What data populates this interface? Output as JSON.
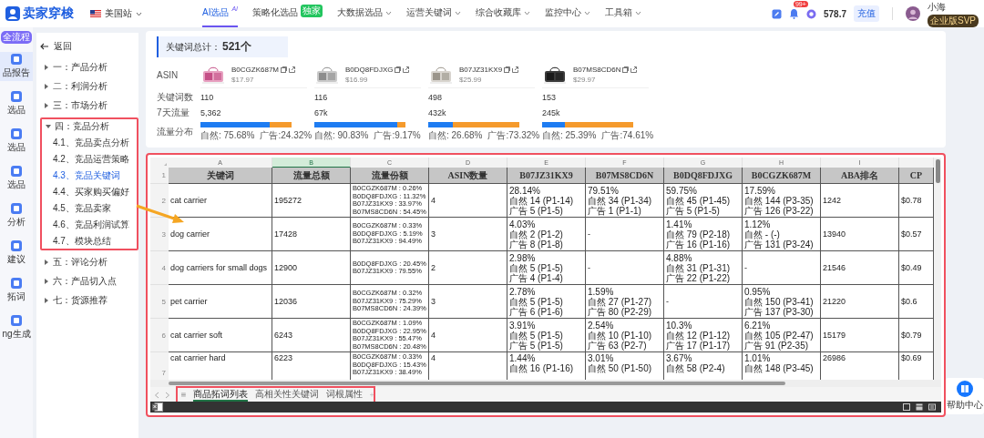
{
  "topbar": {
    "logo": "卖家穿梭",
    "site": "美国站",
    "nav": [
      {
        "label": "AI选品",
        "selected": true,
        "badge": {
          "kind": "sup",
          "text": "AI"
        }
      },
      {
        "label": "策略化选品",
        "selected": false,
        "badge": {
          "kind": "tag",
          "text": "独家"
        }
      },
      {
        "label": "大数据选品",
        "selected": false,
        "dropdown": true
      },
      {
        "label": "运营关键词",
        "selected": false,
        "dropdown": true
      },
      {
        "label": "综合收藏库",
        "selected": false,
        "dropdown": true
      },
      {
        "label": "监控中心",
        "selected": false,
        "dropdown": true
      },
      {
        "label": "工具箱",
        "selected": false,
        "dropdown": true
      }
    ],
    "notifications": "99+",
    "balance": "578.7",
    "recharge": "充值",
    "user": {
      "name": "小海",
      "plan": "企业版SVP"
    }
  },
  "rail": {
    "badge": "全流程",
    "items": [
      {
        "label": "品报告",
        "selected": true
      },
      {
        "label": "选品",
        "selected": false
      },
      {
        "label": "选品",
        "selected": false
      },
      {
        "label": "选品",
        "selected": false
      },
      {
        "label": "分析",
        "selected": false
      },
      {
        "label": "建议",
        "selected": false
      },
      {
        "label": "拓词",
        "selected": false
      },
      {
        "label": "ng生成",
        "selected": false
      }
    ]
  },
  "outline": {
    "back": "返回",
    "items": [
      {
        "label": "一：产品分析",
        "expanded": false,
        "highlighted": false
      },
      {
        "label": "二：利润分析",
        "expanded": false,
        "highlighted": false
      },
      {
        "label": "三：市场分析",
        "expanded": false,
        "highlighted": false
      },
      {
        "label": "四：竞品分析",
        "expanded": true,
        "highlighted": true,
        "children": [
          {
            "label": "4.1、竞品卖点分析",
            "selected": false
          },
          {
            "label": "4.2、竞品运营策略",
            "selected": false
          },
          {
            "label": "4.3、竞品关键词",
            "selected": true
          },
          {
            "label": "4.4、买家购买偏好",
            "selected": false
          },
          {
            "label": "4.5、竞品卖家",
            "selected": false
          },
          {
            "label": "4.6、竞品利润试算",
            "selected": false
          },
          {
            "label": "4.7、模块总结",
            "selected": false
          }
        ]
      },
      {
        "label": "五：评论分析",
        "expanded": false,
        "highlighted": false
      },
      {
        "label": "六：产品切入点",
        "expanded": false,
        "highlighted": false
      },
      {
        "label": "七：货源推荐",
        "expanded": false,
        "highlighted": false
      }
    ]
  },
  "summary": {
    "title": "关键词总计：",
    "count": "521个",
    "row_labels": [
      "ASIN",
      "关键词数",
      "7天流量",
      "流量分布"
    ],
    "products": [
      {
        "asin": "B0CGZK687M",
        "price": "$17.97",
        "keywords": "110",
        "traffic": "5,362",
        "level": 0.7568,
        "natural": "自然: 75.68%",
        "ad": "广告:24.32%"
      },
      {
        "asin": "B0DQ8FDJXG",
        "price": "$16.99",
        "keywords": "116",
        "traffic": "67k",
        "level": 0.9083,
        "natural": "自然: 90.83%",
        "ad": "广告:9.17%"
      },
      {
        "asin": "B07JZ31KX9",
        "price": "$25.99",
        "keywords": "498",
        "traffic": "432k",
        "level": 0.2668,
        "natural": "自然: 26.68%",
        "ad": "广告:73.32%"
      },
      {
        "asin": "B07MS8CD6N",
        "price": "$29.97",
        "keywords": "153",
        "traffic": "245k",
        "level": 0.2539,
        "natural": "自然: 25.39%",
        "ad": "广告:74.61%"
      }
    ]
  },
  "sheet": {
    "highlighted": true,
    "column_letters": [
      {
        "label": "A",
        "selected": false
      },
      {
        "label": "B",
        "selected": true
      },
      {
        "label": "C",
        "selected": false
      },
      {
        "label": "D",
        "selected": false
      },
      {
        "label": "E",
        "selected": false
      },
      {
        "label": "F",
        "selected": false
      },
      {
        "label": "G",
        "selected": false
      },
      {
        "label": "H",
        "selected": false
      },
      {
        "label": "I",
        "selected": false
      }
    ],
    "header_row": "1",
    "headers": [
      "关键词",
      "流量总额",
      "流量份额",
      "ASIN数量",
      "B07JZ31KX9",
      "B07MS8CD6N",
      "B0DQ8FDJXG",
      "B0CGZK687M",
      "ABA排名",
      "CP"
    ],
    "rows": [
      {
        "num": "2",
        "partial": false,
        "cells": [
          [
            "cat carrier"
          ],
          [
            "195272"
          ],
          [
            "B0CGZK687M : 0.26%",
            "B0DQ8FDJXG : 11.32%",
            "B07JZ31KX9 : 33.97%",
            "B07MS8CD6N : 54.45%"
          ],
          [
            "4"
          ],
          [
            "28.14%",
            "自然 14 (P1-14)",
            "广告 5 (P1-5)"
          ],
          [
            "79.51%",
            "自然 34 (P1-34)",
            "广告 1 (P1-1)"
          ],
          [
            "59.75%",
            "自然 45 (P1-45)",
            "广告 5 (P1-5)"
          ],
          [
            "17.59%",
            "自然 144 (P3-35)",
            "广告 126 (P3-22)"
          ],
          [
            "1242"
          ],
          [
            "$0.78"
          ]
        ]
      },
      {
        "num": "3",
        "partial": false,
        "cells": [
          [
            "dog carrier"
          ],
          [
            "17428"
          ],
          [
            "B0CGZK687M : 0.33%",
            "B0DQ8FDJXG : 5.19%",
            "B07JZ31KX9 : 94.49%"
          ],
          [
            "3"
          ],
          [
            "4.03%",
            "自然 2 (P1-2)",
            "广告 8 (P1-8)"
          ],
          [
            "-"
          ],
          [
            "1.41%",
            "自然 79 (P2-18)",
            "广告 16 (P1-16)"
          ],
          [
            "1.12%",
            "自然 - (-)",
            "广告 131 (P3-24)"
          ],
          [
            "13940"
          ],
          [
            "$0.57"
          ]
        ]
      },
      {
        "num": "4",
        "partial": false,
        "cells": [
          [
            "dog carriers for small dogs"
          ],
          [
            "12900"
          ],
          [
            "B0DQ8FDJXG : 20.45%",
            "B07JZ31KX9 : 79.55%"
          ],
          [
            "2"
          ],
          [
            "2.98%",
            "自然 5 (P1-5)",
            "广告 4 (P1-4)"
          ],
          [
            "-"
          ],
          [
            "4.88%",
            "自然 31 (P1-31)",
            "广告 22 (P1-22)"
          ],
          [
            "-"
          ],
          [
            "21546"
          ],
          [
            "$0.49"
          ]
        ]
      },
      {
        "num": "5",
        "partial": false,
        "cells": [
          [
            "pet carrier"
          ],
          [
            "12036"
          ],
          [
            "B0CGZK687M : 0.32%",
            "B07JZ31KX9 : 75.29%",
            "B07MS8CD6N : 24.39%"
          ],
          [
            "3"
          ],
          [
            "2.78%",
            "自然 5 (P1-5)",
            "广告 6 (P1-6)"
          ],
          [
            "1.59%",
            "自然 27 (P1-27)",
            "广告 80 (P2-29)"
          ],
          [
            "-"
          ],
          [
            "0.95%",
            "自然 150 (P3-41)",
            "广告 137 (P3-30)"
          ],
          [
            "21220"
          ],
          [
            "$0.6"
          ]
        ]
      },
      {
        "num": "6",
        "partial": false,
        "cells": [
          [
            "cat carrier soft"
          ],
          [
            "6243"
          ],
          [
            "B0CGZK687M : 1.09%",
            "B0DQ8FDJXG : 22.95%",
            "B07JZ31KX9 : 55.47%",
            "B07MS8CD6N : 20.48%"
          ],
          [
            "4"
          ],
          [
            "3.91%",
            "自然 5 (P1-5)",
            "广告 5 (P1-5)"
          ],
          [
            "2.54%",
            "自然 10 (P1-10)",
            "广告 63 (P2-7)"
          ],
          [
            "10.3%",
            "自然 12 (P1-12)",
            "广告 17 (P1-17)"
          ],
          [
            "6.21%",
            "自然 105 (P2-47)",
            "广告 91 (P2-35)"
          ],
          [
            "15179"
          ],
          [
            "$0.79"
          ]
        ]
      },
      {
        "num": "7",
        "partial": true,
        "cells": [
          [
            "cat carrier hard"
          ],
          [
            "6223"
          ],
          [
            "B0CGZK687M : 0.33%",
            "B0DQ8FDJXG : 15.43%",
            "B07JZ31KX9 : 38.49%"
          ],
          [
            "4"
          ],
          [
            "1.44%",
            "自然 16 (P1-16)"
          ],
          [
            "3.01%",
            "自然 50 (P1-50)"
          ],
          [
            "3.67%",
            "自然 58 (P2-4)"
          ],
          [
            "1.01%",
            "自然 148 (P3-45)"
          ],
          [
            "26986"
          ],
          [
            "$0.69"
          ]
        ]
      }
    ],
    "tabs": [
      {
        "label": "商品拓词列表",
        "selected": true
      },
      {
        "label": "高相关性关键词",
        "selected": false
      },
      {
        "label": "词根属性",
        "selected": false
      }
    ],
    "tabs_highlighted": true
  },
  "help": {
    "label": "帮助中心"
  }
}
